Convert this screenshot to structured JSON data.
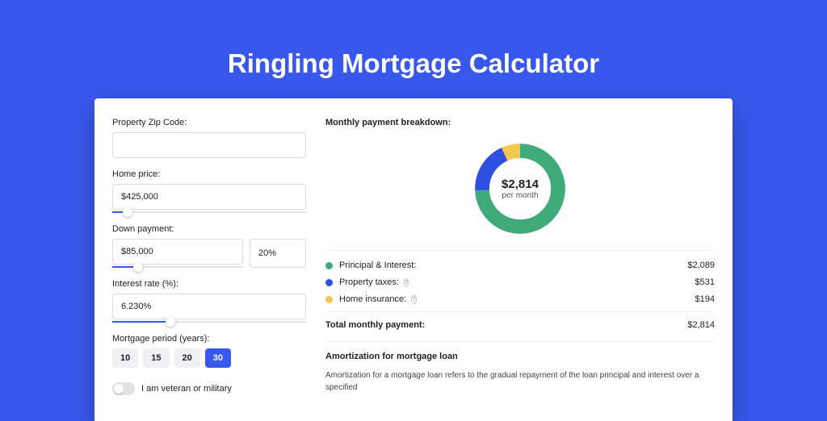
{
  "title": "Ringling Mortgage Calculator",
  "form": {
    "zip_label": "Property Zip Code:",
    "zip_value": "",
    "price_label": "Home price:",
    "price_value": "$425,000",
    "price_slider_pct": 8,
    "down_label": "Down payment:",
    "down_value": "$85,000",
    "down_pct_value": "20%",
    "down_slider_pct": 20,
    "rate_label": "Interest rate (%):",
    "rate_value": "6.230%",
    "rate_slider_pct": 30,
    "term_label": "Mortgage period (years):",
    "terms": [
      "10",
      "15",
      "20",
      "30"
    ],
    "term_selected": "30",
    "veteran_label": "I am veteran or military",
    "veteran_on": false
  },
  "breakdown": {
    "heading": "Monthly payment breakdown:",
    "center_amount": "$2,814",
    "center_sub": "per month",
    "items": [
      {
        "label": "Principal & Interest:",
        "value": "$2,089",
        "color": "#3fab7b",
        "info": false
      },
      {
        "label": "Property taxes:",
        "value": "$531",
        "color": "#2e4fe0",
        "info": true
      },
      {
        "label": "Home insurance:",
        "value": "$194",
        "color": "#f2c94c",
        "info": true
      }
    ],
    "total_label": "Total monthly payment:",
    "total_value": "$2,814"
  },
  "amort": {
    "heading": "Amortization for mortgage loan",
    "para": "Amortization for a mortgage loan refers to the gradual repayment of the loan principal and interest over a specified"
  },
  "chart_data": {
    "type": "pie",
    "title": "Monthly payment breakdown",
    "series": [
      {
        "name": "Principal & Interest",
        "value": 2089,
        "color": "#3fab7b"
      },
      {
        "name": "Property taxes",
        "value": 531,
        "color": "#2e4fe0"
      },
      {
        "name": "Home insurance",
        "value": 194,
        "color": "#f2c94c"
      }
    ],
    "total": 2814
  }
}
